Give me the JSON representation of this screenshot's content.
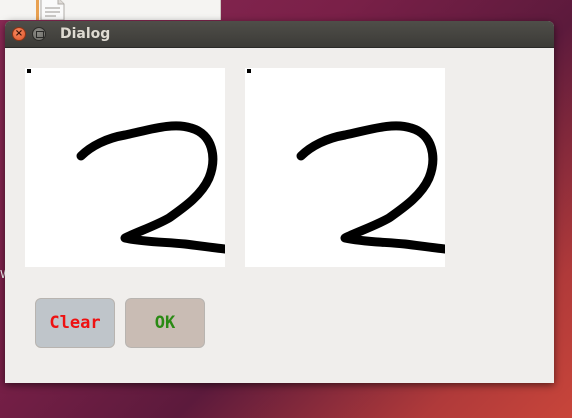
{
  "dialog": {
    "title": "Dialog"
  },
  "buttons": {
    "clear_label": "Clear",
    "ok_label": "OK"
  },
  "background": {
    "edge_text": "W"
  },
  "colors": {
    "clear_text": "#ee1111",
    "ok_text": "#2a8a14",
    "stroke": "#000000"
  },
  "icons": {
    "close": "close-icon",
    "maximize": "maximize-icon",
    "file": "file-icon"
  }
}
